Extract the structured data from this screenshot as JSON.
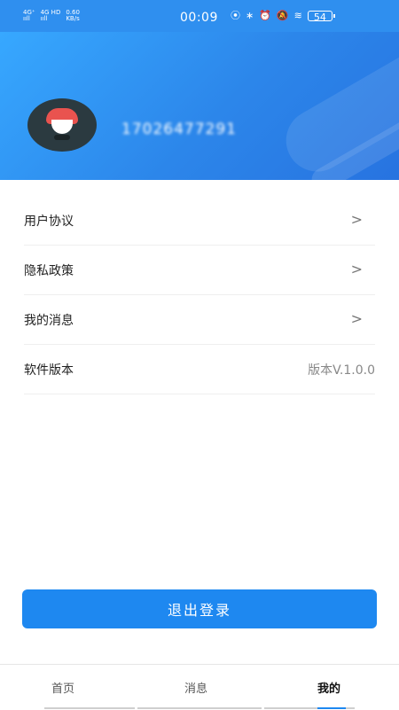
{
  "status_bar": {
    "signal1": "4G⁺\nııll",
    "signal2": "4G HD\nııll",
    "net_speed": "0.60\nKB/s",
    "time": "00:09",
    "battery": "54"
  },
  "profile": {
    "phone": "17026477291"
  },
  "menu": {
    "items": [
      {
        "label": "用户协议"
      },
      {
        "label": "隐私政策"
      },
      {
        "label": "我的消息"
      },
      {
        "label": "软件版本",
        "value": "版本V.1.0.0"
      }
    ]
  },
  "logout_label": "退出登录",
  "tabs": [
    {
      "label": "首页"
    },
    {
      "label": "消息"
    },
    {
      "label": "我的"
    }
  ],
  "colors": {
    "primary": "#1e88f0",
    "header_start": "#37a8ff",
    "header_end": "#2773e0"
  }
}
